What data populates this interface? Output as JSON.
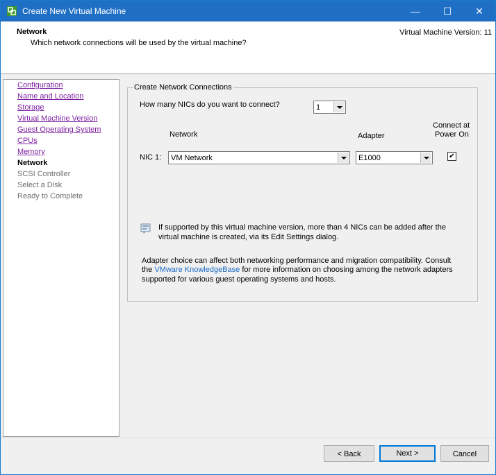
{
  "window": {
    "title": "Create New Virtual Machine",
    "controls": {
      "minimize": "—",
      "maximize": "☐",
      "close": "✕"
    }
  },
  "header": {
    "title": "Network",
    "subtitle": "Which network connections will be used by the virtual machine?",
    "version": "Virtual Machine Version: 11"
  },
  "steps": [
    {
      "label": "Configuration",
      "state": "done"
    },
    {
      "label": "Name and Location",
      "state": "done"
    },
    {
      "label": "Storage",
      "state": "done"
    },
    {
      "label": "Virtual Machine Version",
      "state": "done"
    },
    {
      "label": "Guest Operating System",
      "state": "done"
    },
    {
      "label": "CPUs",
      "state": "done"
    },
    {
      "label": "Memory",
      "state": "done"
    },
    {
      "label": "Network",
      "state": "current"
    },
    {
      "label": "SCSI Controller",
      "state": "future"
    },
    {
      "label": "Select a Disk",
      "state": "future"
    },
    {
      "label": "Ready to Complete",
      "state": "future"
    }
  ],
  "group": {
    "legend": "Create Network Connections",
    "nic_question": "How many NICs do you want to connect?",
    "nic_count": "1",
    "col_network": "Network",
    "col_adapter": "Adapter",
    "col_connect_line1": "Connect at",
    "col_connect_line2": "Power On",
    "nic_label": "NIC 1:",
    "network_value": "VM Network",
    "adapter_value": "E1000",
    "connect_checked": "✔",
    "info_line1": "If supported by this virtual machine version, more than 4 NICs can be added after the",
    "info_line2": "virtual machine is created, via its Edit Settings dialog.",
    "adapter_line1": "Adapter choice can affect both networking performance and migration compatibility. Consult",
    "adapter_line2_pre": "the ",
    "adapter_link": "VMware KnowledgeBase",
    "adapter_line2_post": " for more information on choosing among the network adapters",
    "adapter_line3": "supported for various guest operating systems and hosts."
  },
  "buttons": {
    "back": "< Back",
    "next": "Next >",
    "cancel": "Cancel"
  },
  "colors": {
    "titlebar": "#1f6fc5",
    "visited_link": "#7d1fa0",
    "link": "#1a6bc5"
  },
  "icons": {
    "app": "vmware-logo-icon",
    "info": "info-icon"
  }
}
